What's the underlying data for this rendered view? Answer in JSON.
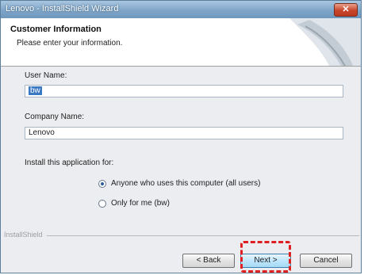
{
  "window": {
    "title": "Lenovo - InstallShield Wizard",
    "close_label": "✕"
  },
  "header": {
    "title": "Customer Information",
    "subtitle": "Please enter your information."
  },
  "form": {
    "user_name_label": "User Name:",
    "user_name_value": "bw",
    "company_name_label": "Company Name:",
    "company_name_value": "Lenovo",
    "install_for_label": "Install this application for:",
    "options": [
      {
        "label": "Anyone who uses this computer (all users)",
        "selected": true
      },
      {
        "label": "Only for me (bw)",
        "selected": false
      }
    ]
  },
  "footer": {
    "brand": "InstallShield",
    "back_label": "< Back",
    "next_label": "Next >",
    "cancel_label": "Cancel"
  }
}
